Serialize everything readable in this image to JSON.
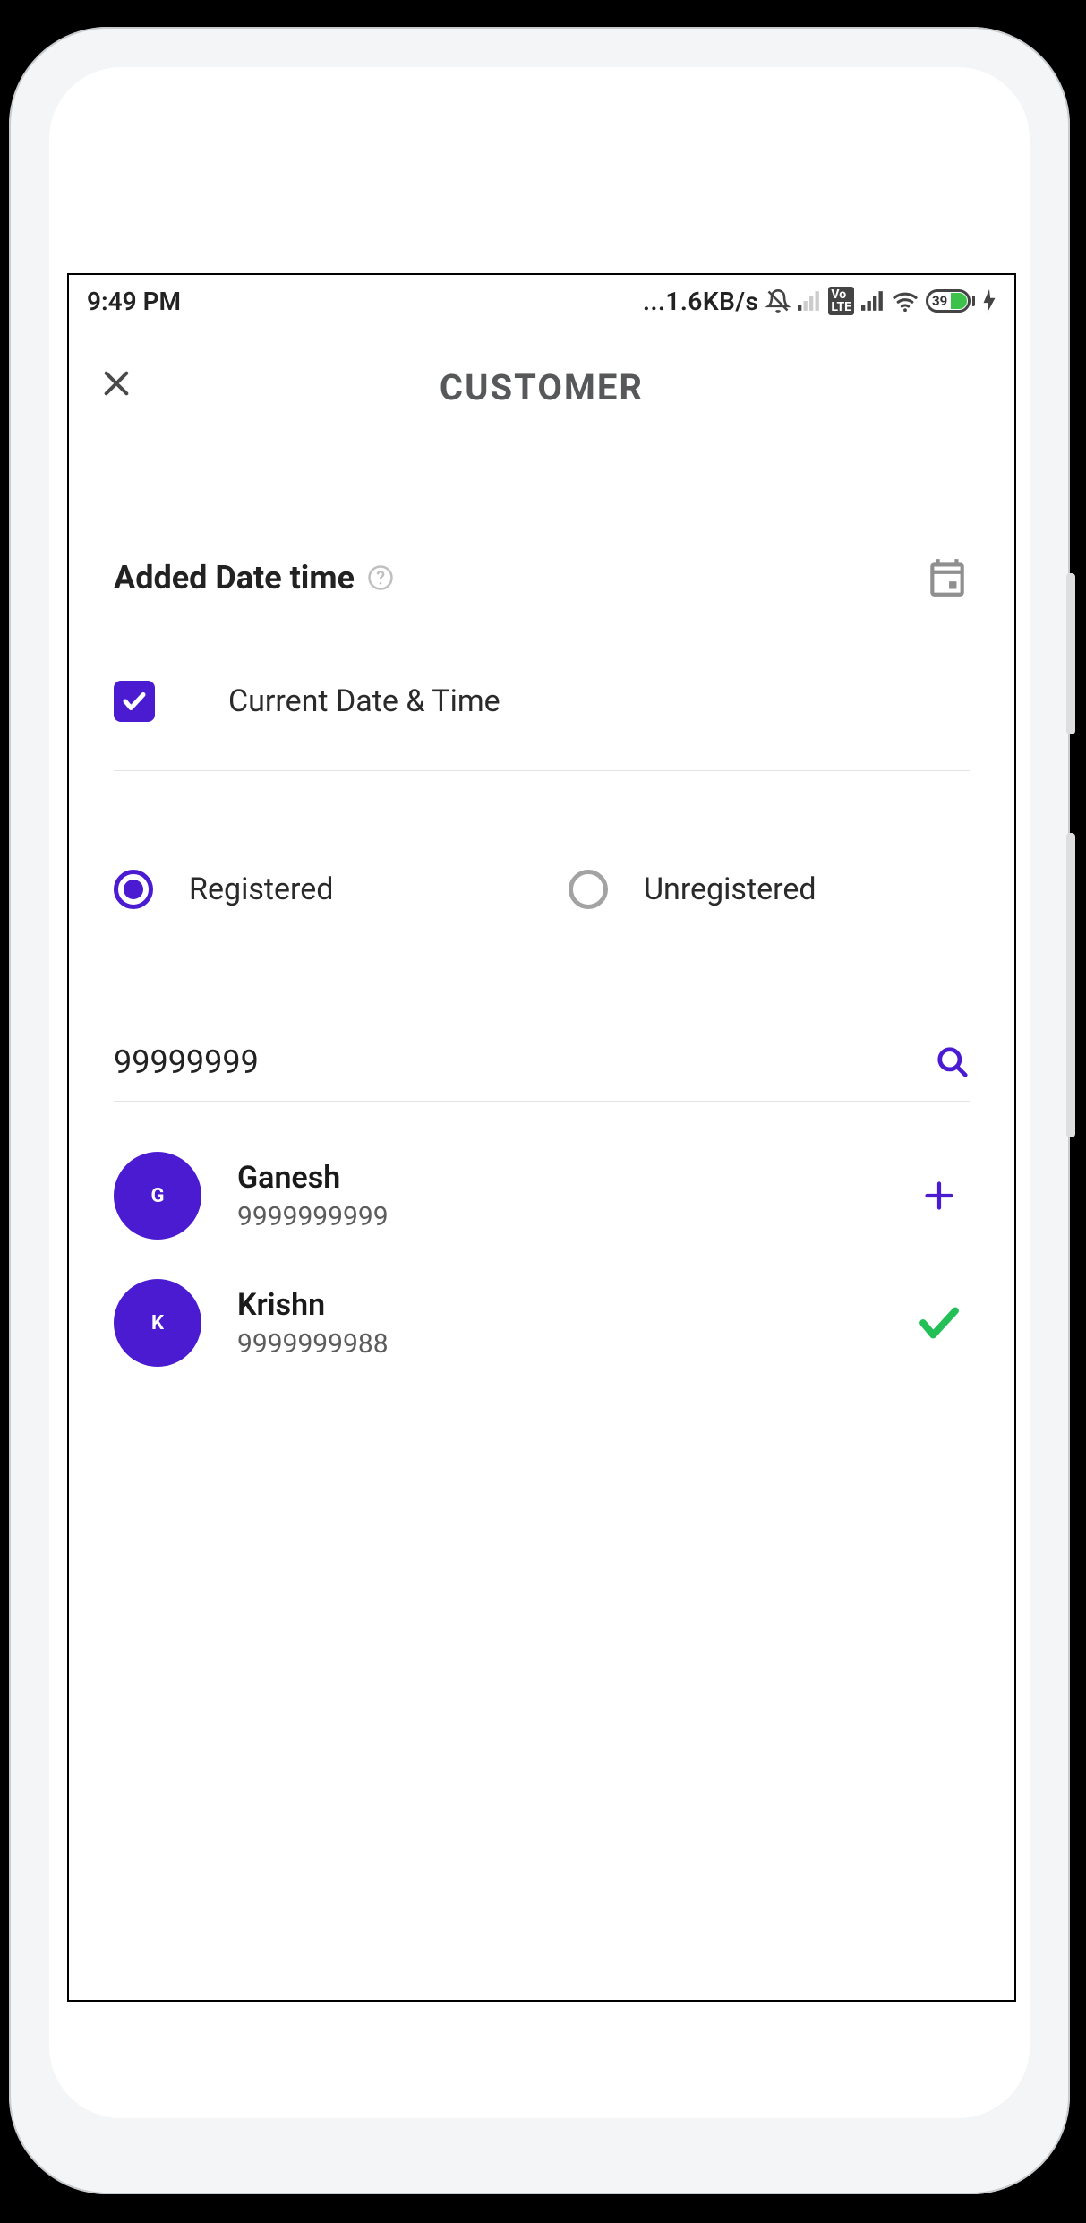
{
  "status": {
    "time": "9:49 PM",
    "net": "...1.6KB/s",
    "battery": "39"
  },
  "header": {
    "title": "CUSTOMER"
  },
  "datetime": {
    "label": "Added Date time",
    "checkbox_label": "Current Date & Time",
    "checked": true
  },
  "type_filter": {
    "registered_label": "Registered",
    "unregistered_label": "Unregistered",
    "selected": "registered"
  },
  "search": {
    "value": "99999999"
  },
  "customers": [
    {
      "initial": "G",
      "name": "Ganesh",
      "phone": "9999999999",
      "state": "add"
    },
    {
      "initial": "K",
      "name": "Krishn",
      "phone": "9999999988",
      "state": "selected"
    }
  ],
  "colors": {
    "primary": "#4a1bd1",
    "success": "#23c057"
  }
}
